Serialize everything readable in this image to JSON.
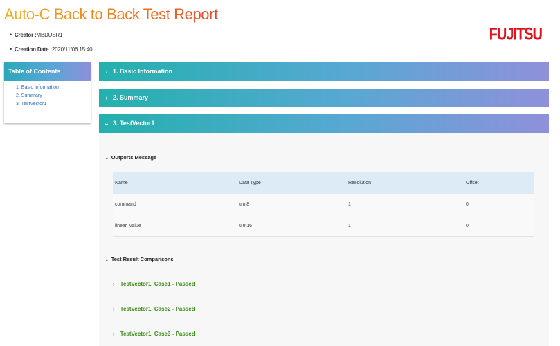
{
  "report_title": "Auto-C Back to Back Test Report",
  "meta": {
    "creator_label": "Creator :",
    "creator_value": "MBDUSR1",
    "date_label": "Creation Date :",
    "date_value": "2020/11/06 15:40"
  },
  "logo_text": "FUJITSU",
  "toc": {
    "title": "Table of Contents",
    "items": [
      "1. Basic Information",
      "2. Summary",
      "3. TestVector1"
    ]
  },
  "sections": [
    "1. Basic Information",
    "2. Summary",
    "3. TestVector1"
  ],
  "outports": {
    "heading": "Outports Message",
    "columns": [
      "Name",
      "Data Type",
      "Resolution",
      "Offset"
    ],
    "rows": [
      [
        "command",
        "uint8",
        "1",
        "0"
      ],
      [
        "linear_value",
        "uint16",
        "1",
        "0"
      ]
    ]
  },
  "comparisons": {
    "heading": "Test Result Comparisons",
    "cases": [
      "TestVector1_Case1 - Passed",
      "TestVector1_Case2 - Passed",
      "TestVector1_Case3 - Passed"
    ]
  },
  "colors": {
    "passed": "#3d8c1c",
    "logo": "#e0101a",
    "toc_link": "#2a6fba"
  }
}
